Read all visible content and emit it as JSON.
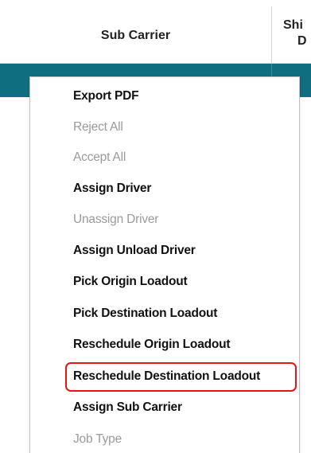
{
  "table": {
    "columns": [
      {
        "label": "Sub Carrier"
      },
      {
        "label_line1": "Shi",
        "label_line2": "D"
      }
    ]
  },
  "context_menu": {
    "items": [
      {
        "label": "Export PDF",
        "enabled": true
      },
      {
        "label": "Reject All",
        "enabled": false
      },
      {
        "label": "Accept All",
        "enabled": false
      },
      {
        "label": "Assign Driver",
        "enabled": true
      },
      {
        "label": "Unassign Driver",
        "enabled": false
      },
      {
        "label": "Assign Unload Driver",
        "enabled": true
      },
      {
        "label": "Pick Origin Loadout",
        "enabled": true
      },
      {
        "label": "Pick Destination Loadout",
        "enabled": true
      },
      {
        "label": "Reschedule Origin Loadout",
        "enabled": true
      },
      {
        "label": "Reschedule Destination Loadout",
        "enabled": true,
        "highlighted": true
      },
      {
        "label": "Assign Sub Carrier",
        "enabled": true
      },
      {
        "label": "Job Type",
        "enabled": false
      }
    ]
  },
  "colors": {
    "selected_row": "#0f6f80",
    "highlight_border": "#e3151a",
    "enabled_text": "#111111",
    "disabled_text": "#9a9a9a"
  }
}
